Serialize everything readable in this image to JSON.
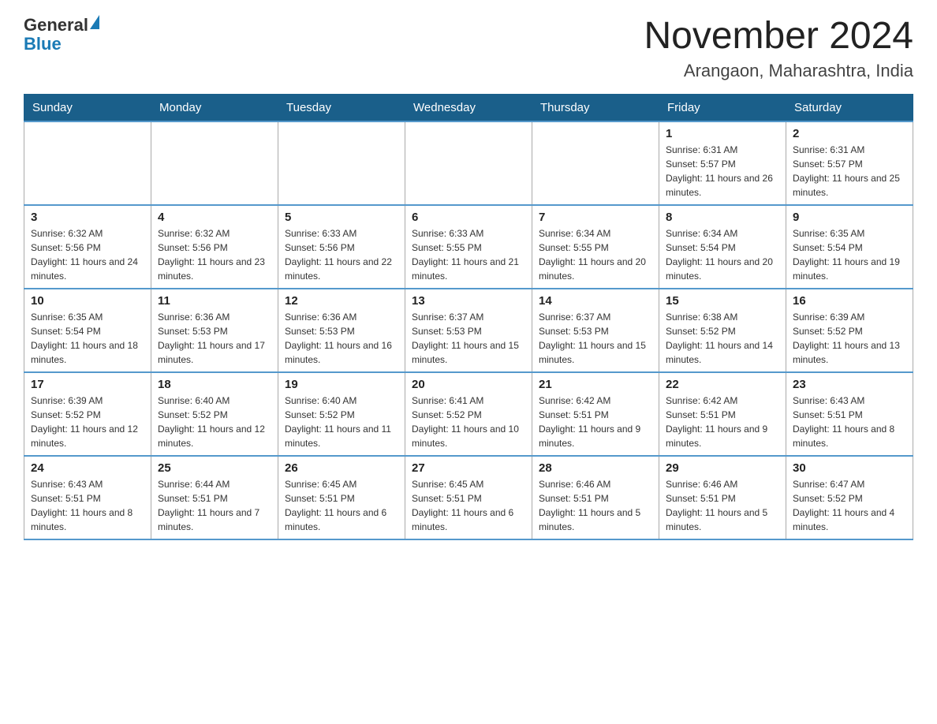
{
  "header": {
    "logo_line1": "General",
    "logo_triangle": "▶",
    "logo_line2": "Blue",
    "month_title": "November 2024",
    "location": "Arangaon, Maharashtra, India"
  },
  "weekdays": [
    "Sunday",
    "Monday",
    "Tuesday",
    "Wednesday",
    "Thursday",
    "Friday",
    "Saturday"
  ],
  "weeks": [
    [
      {
        "day": "",
        "info": ""
      },
      {
        "day": "",
        "info": ""
      },
      {
        "day": "",
        "info": ""
      },
      {
        "day": "",
        "info": ""
      },
      {
        "day": "",
        "info": ""
      },
      {
        "day": "1",
        "info": "Sunrise: 6:31 AM\nSunset: 5:57 PM\nDaylight: 11 hours and 26 minutes."
      },
      {
        "day": "2",
        "info": "Sunrise: 6:31 AM\nSunset: 5:57 PM\nDaylight: 11 hours and 25 minutes."
      }
    ],
    [
      {
        "day": "3",
        "info": "Sunrise: 6:32 AM\nSunset: 5:56 PM\nDaylight: 11 hours and 24 minutes."
      },
      {
        "day": "4",
        "info": "Sunrise: 6:32 AM\nSunset: 5:56 PM\nDaylight: 11 hours and 23 minutes."
      },
      {
        "day": "5",
        "info": "Sunrise: 6:33 AM\nSunset: 5:56 PM\nDaylight: 11 hours and 22 minutes."
      },
      {
        "day": "6",
        "info": "Sunrise: 6:33 AM\nSunset: 5:55 PM\nDaylight: 11 hours and 21 minutes."
      },
      {
        "day": "7",
        "info": "Sunrise: 6:34 AM\nSunset: 5:55 PM\nDaylight: 11 hours and 20 minutes."
      },
      {
        "day": "8",
        "info": "Sunrise: 6:34 AM\nSunset: 5:54 PM\nDaylight: 11 hours and 20 minutes."
      },
      {
        "day": "9",
        "info": "Sunrise: 6:35 AM\nSunset: 5:54 PM\nDaylight: 11 hours and 19 minutes."
      }
    ],
    [
      {
        "day": "10",
        "info": "Sunrise: 6:35 AM\nSunset: 5:54 PM\nDaylight: 11 hours and 18 minutes."
      },
      {
        "day": "11",
        "info": "Sunrise: 6:36 AM\nSunset: 5:53 PM\nDaylight: 11 hours and 17 minutes."
      },
      {
        "day": "12",
        "info": "Sunrise: 6:36 AM\nSunset: 5:53 PM\nDaylight: 11 hours and 16 minutes."
      },
      {
        "day": "13",
        "info": "Sunrise: 6:37 AM\nSunset: 5:53 PM\nDaylight: 11 hours and 15 minutes."
      },
      {
        "day": "14",
        "info": "Sunrise: 6:37 AM\nSunset: 5:53 PM\nDaylight: 11 hours and 15 minutes."
      },
      {
        "day": "15",
        "info": "Sunrise: 6:38 AM\nSunset: 5:52 PM\nDaylight: 11 hours and 14 minutes."
      },
      {
        "day": "16",
        "info": "Sunrise: 6:39 AM\nSunset: 5:52 PM\nDaylight: 11 hours and 13 minutes."
      }
    ],
    [
      {
        "day": "17",
        "info": "Sunrise: 6:39 AM\nSunset: 5:52 PM\nDaylight: 11 hours and 12 minutes."
      },
      {
        "day": "18",
        "info": "Sunrise: 6:40 AM\nSunset: 5:52 PM\nDaylight: 11 hours and 12 minutes."
      },
      {
        "day": "19",
        "info": "Sunrise: 6:40 AM\nSunset: 5:52 PM\nDaylight: 11 hours and 11 minutes."
      },
      {
        "day": "20",
        "info": "Sunrise: 6:41 AM\nSunset: 5:52 PM\nDaylight: 11 hours and 10 minutes."
      },
      {
        "day": "21",
        "info": "Sunrise: 6:42 AM\nSunset: 5:51 PM\nDaylight: 11 hours and 9 minutes."
      },
      {
        "day": "22",
        "info": "Sunrise: 6:42 AM\nSunset: 5:51 PM\nDaylight: 11 hours and 9 minutes."
      },
      {
        "day": "23",
        "info": "Sunrise: 6:43 AM\nSunset: 5:51 PM\nDaylight: 11 hours and 8 minutes."
      }
    ],
    [
      {
        "day": "24",
        "info": "Sunrise: 6:43 AM\nSunset: 5:51 PM\nDaylight: 11 hours and 8 minutes."
      },
      {
        "day": "25",
        "info": "Sunrise: 6:44 AM\nSunset: 5:51 PM\nDaylight: 11 hours and 7 minutes."
      },
      {
        "day": "26",
        "info": "Sunrise: 6:45 AM\nSunset: 5:51 PM\nDaylight: 11 hours and 6 minutes."
      },
      {
        "day": "27",
        "info": "Sunrise: 6:45 AM\nSunset: 5:51 PM\nDaylight: 11 hours and 6 minutes."
      },
      {
        "day": "28",
        "info": "Sunrise: 6:46 AM\nSunset: 5:51 PM\nDaylight: 11 hours and 5 minutes."
      },
      {
        "day": "29",
        "info": "Sunrise: 6:46 AM\nSunset: 5:51 PM\nDaylight: 11 hours and 5 minutes."
      },
      {
        "day": "30",
        "info": "Sunrise: 6:47 AM\nSunset: 5:52 PM\nDaylight: 11 hours and 4 minutes."
      }
    ]
  ]
}
